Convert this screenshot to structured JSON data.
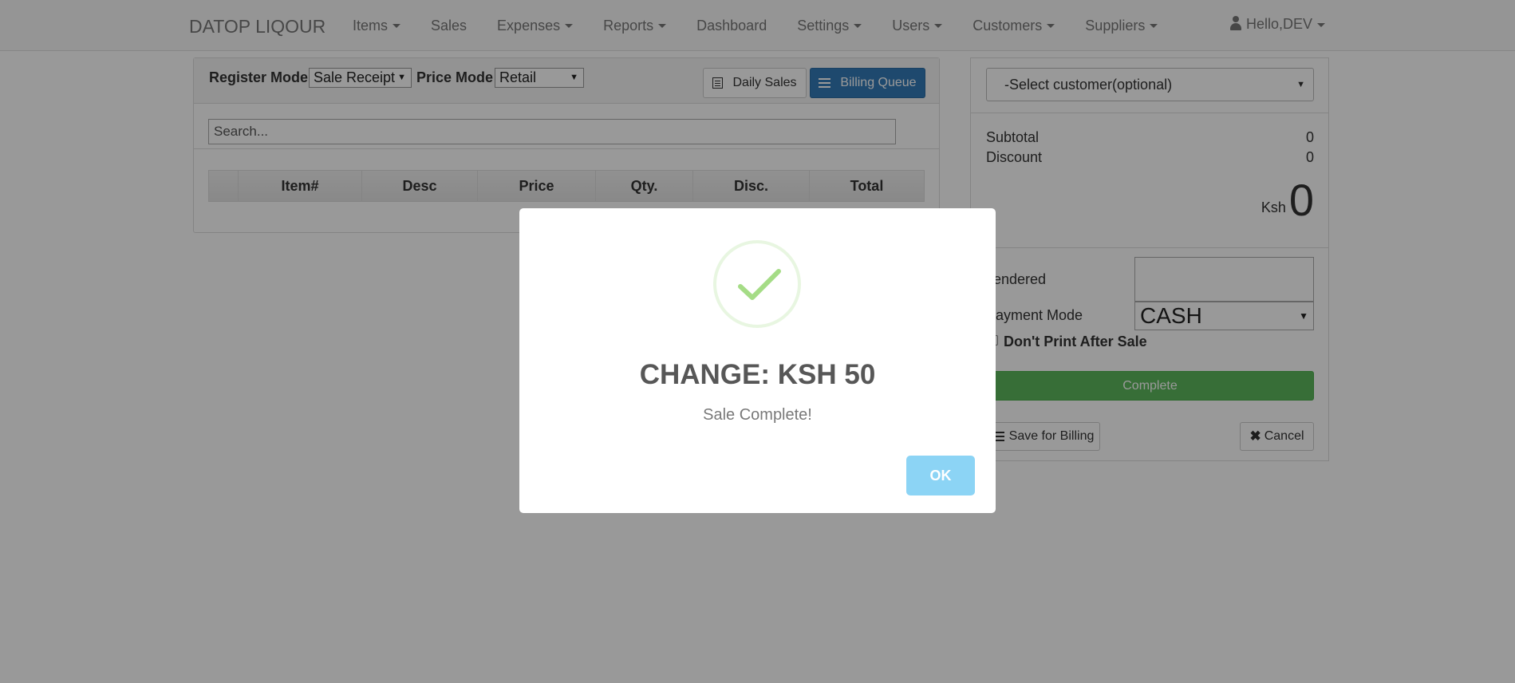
{
  "navbar": {
    "brand": "DATOP LIQOUR",
    "items": [
      {
        "label": "Items",
        "dropdown": true
      },
      {
        "label": "Sales",
        "dropdown": false
      },
      {
        "label": "Expenses",
        "dropdown": true
      },
      {
        "label": "Reports",
        "dropdown": true
      },
      {
        "label": "Dashboard",
        "dropdown": false
      },
      {
        "label": "Settings",
        "dropdown": true
      },
      {
        "label": "Users",
        "dropdown": true
      },
      {
        "label": "Customers",
        "dropdown": true
      },
      {
        "label": "Suppliers",
        "dropdown": true
      }
    ],
    "user_label": "Hello,DEV",
    "user_icon": "user-icon"
  },
  "register": {
    "register_mode_label": "Register Mode",
    "register_mode_value": "Sale Receipt",
    "price_mode_label": "Price Mode",
    "price_mode_value": "Retail",
    "daily_sales_label": "Daily Sales",
    "billing_queue_label": "Billing Queue",
    "search_placeholder": "Search...",
    "columns": [
      "",
      "Item#",
      "Desc",
      "Price",
      "Qty.",
      "Disc.",
      "Total"
    ]
  },
  "summary": {
    "customer_select": "-Select customer(optional)",
    "subtotal_label": "Subtotal",
    "subtotal_value": "0",
    "discount_label": "Discount",
    "discount_value": "0",
    "currency": "Ksh",
    "total": "0",
    "tendered_label": "Tendered",
    "tendered_value": "",
    "payment_mode_label": "Payment Mode",
    "payment_mode_value": "CASH",
    "dont_print_label": "Don't Print After Sale",
    "dont_print_checked": false,
    "complete_label": "Complete",
    "save_billing_label": "Save for Billing",
    "cancel_label": "Cancel"
  },
  "modal": {
    "icon": "success-check-icon",
    "title": "CHANGE: KSH 50",
    "text": "Sale Complete!",
    "ok_label": "OK"
  },
  "colors": {
    "primary": "#337ab7",
    "success": "#5cb85c",
    "ok_button": "#8cd4f5",
    "check": "#a5dc86"
  }
}
